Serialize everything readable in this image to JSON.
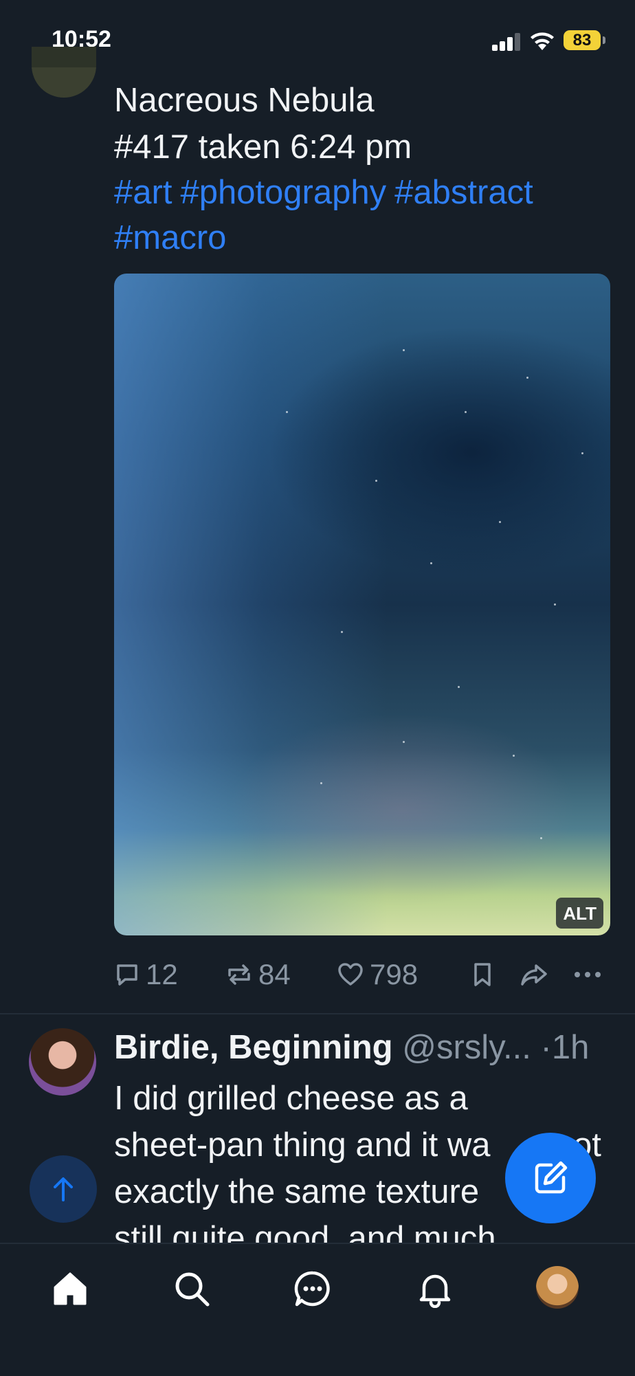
{
  "status_bar": {
    "time": "10:52",
    "battery": "83",
    "icons": [
      "cellular-signal-icon",
      "wifi-icon",
      "battery-icon"
    ]
  },
  "post": {
    "title_line1": "Nacreous Nebula",
    "title_line2": "#417 taken 6:24 pm",
    "hashtags": [
      "#art",
      "#photography",
      "#abstract",
      "#macro"
    ],
    "image_alt_badge": "ALT",
    "actions": {
      "replies": "12",
      "reposts": "84",
      "likes": "798"
    }
  },
  "next_post": {
    "author": "Birdie, Beginning",
    "handle": "@srsly...",
    "separator": "·",
    "time": "1h",
    "body_lines": [
      "I did grilled cheese as a",
      "sheet-pan thing and it wa",
      "exactly the same texture",
      "still quite good, and much"
    ],
    "body_line2_tail": "ot"
  },
  "nav": {
    "items": [
      "home-icon",
      "search-icon",
      "chat-icon",
      "notifications-icon",
      "profile-avatar"
    ]
  },
  "colors": {
    "background": "#161e27",
    "accent": "#1677f5",
    "hashtag": "#2f7ff5",
    "muted": "#8a96a3",
    "battery": "#f3d238"
  }
}
